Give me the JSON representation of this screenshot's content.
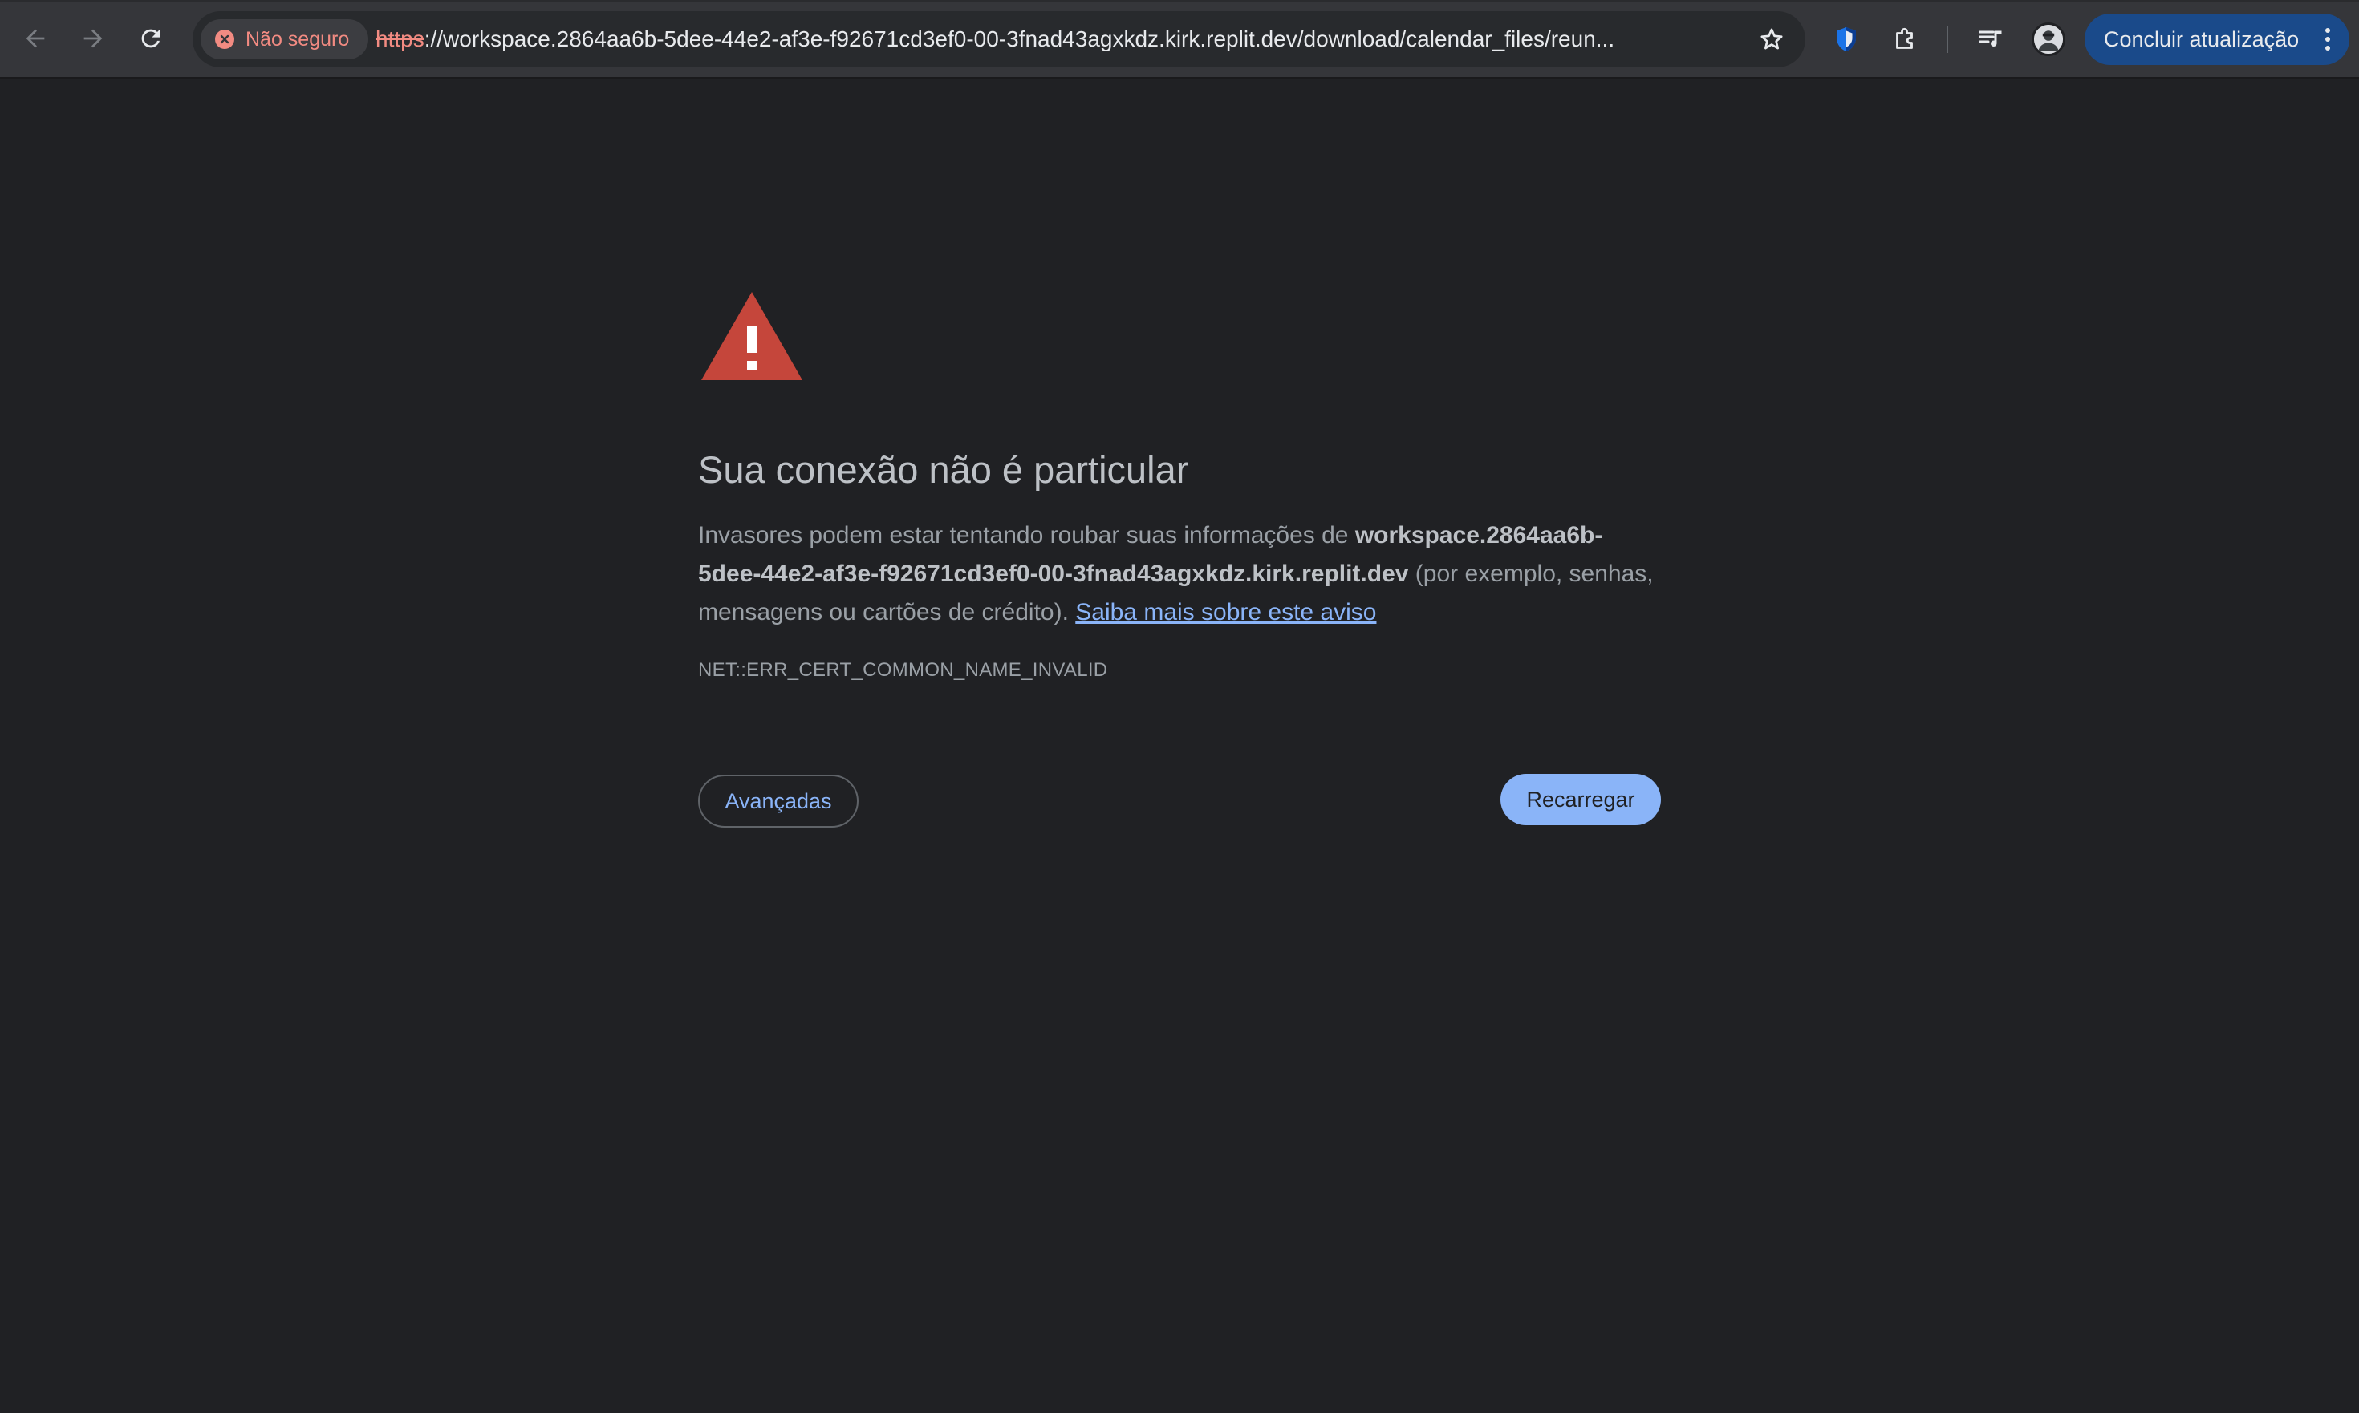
{
  "browser": {
    "security_chip": {
      "label": "Não seguro"
    },
    "url": {
      "scheme": "https",
      "rest": "://workspace.2864aa6b-5dee-44e2-af3e-f92671cd3ef0-00-3fnad43agxkdz.kirk.replit.dev/download/calendar_files/reun..."
    },
    "update_button": {
      "label": "Concluir atualização"
    },
    "icons": {
      "back": "arrow-left-icon",
      "forward": "arrow-right-icon",
      "reload": "reload-icon",
      "bookmark": "star-icon",
      "shield": "shield-extension-icon",
      "extensions": "puzzle-icon",
      "media": "media-controls-icon",
      "profile": "avatar",
      "menu": "kebab-menu-icon"
    }
  },
  "interstitial": {
    "heading": "Sua conexão não é particular",
    "body_prefix": "Invasores podem estar tentando roubar suas informações de ",
    "host": "workspace.2864aa6b-5dee-44e2-af3e-f92671cd3ef0-00-3fnad43agxkdz.kirk.replit.dev",
    "body_suffix": " (por exemplo, senhas, mensagens ou cartões de crédito). ",
    "learn_more_link": "Saiba mais sobre este aviso",
    "error_code": "NET::ERR_CERT_COMMON_NAME_INVALID",
    "advanced_button": "Avançadas",
    "reload_button": "Recarregar"
  },
  "colors": {
    "page_background": "#202124",
    "toolbar_background": "#35363a",
    "danger": "#f28b82",
    "warning_triangle": "#c5463b",
    "link": "#8ab4f8",
    "primary_button": "#8ab4f8",
    "update_button": "#1a4a8a"
  }
}
